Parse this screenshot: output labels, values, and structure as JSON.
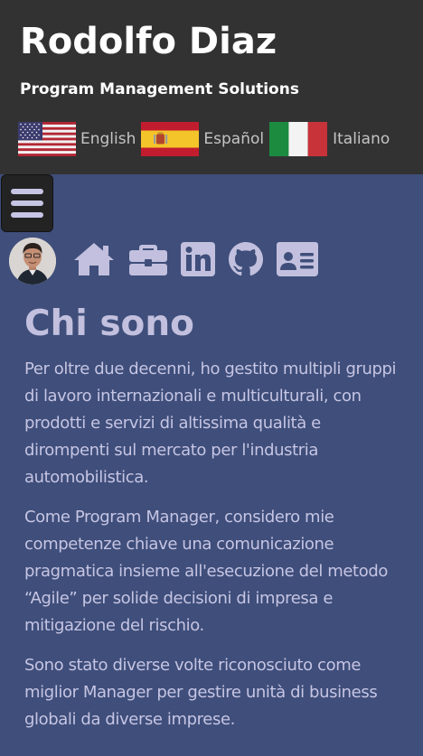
{
  "header": {
    "title": "Rodolfo Diaz",
    "subtitle": "Program Management Solutions"
  },
  "languages": [
    {
      "label": "English",
      "flag": "us-flag-icon"
    },
    {
      "label": "Español",
      "flag": "spain-flag-icon"
    },
    {
      "label": "Italiano",
      "flag": "italy-flag-icon"
    }
  ],
  "nav": {
    "menu_icon": "hamburger-menu-icon",
    "icons": [
      "avatar",
      "home-icon",
      "briefcase-icon",
      "linkedin-icon",
      "github-icon",
      "contact-card-icon"
    ]
  },
  "main": {
    "heading": "Chi sono",
    "paragraphs": [
      "Per oltre due decenni, ho gestito multipli gruppi di lavoro internazionali e multiculturali, con prodotti e servizi di altissima qualità e dirompenti sul mercato per l'industria automobilistica.",
      "Come Program Manager, considero mie competenze chiave una comunicazione pragmatica insieme all'esecuzione del metodo “Agile” per solide decisioni di impresa e mitigazione del rischio.",
      "Sono stato diverse volte riconosciuto come miglior Manager per gestire unità di business globali da diverse imprese."
    ]
  },
  "colors": {
    "header_bg": "#333233",
    "page_bg": "#3f4e7a",
    "icon_color": "#c2c0de",
    "text_color": "#c6c5e4"
  }
}
